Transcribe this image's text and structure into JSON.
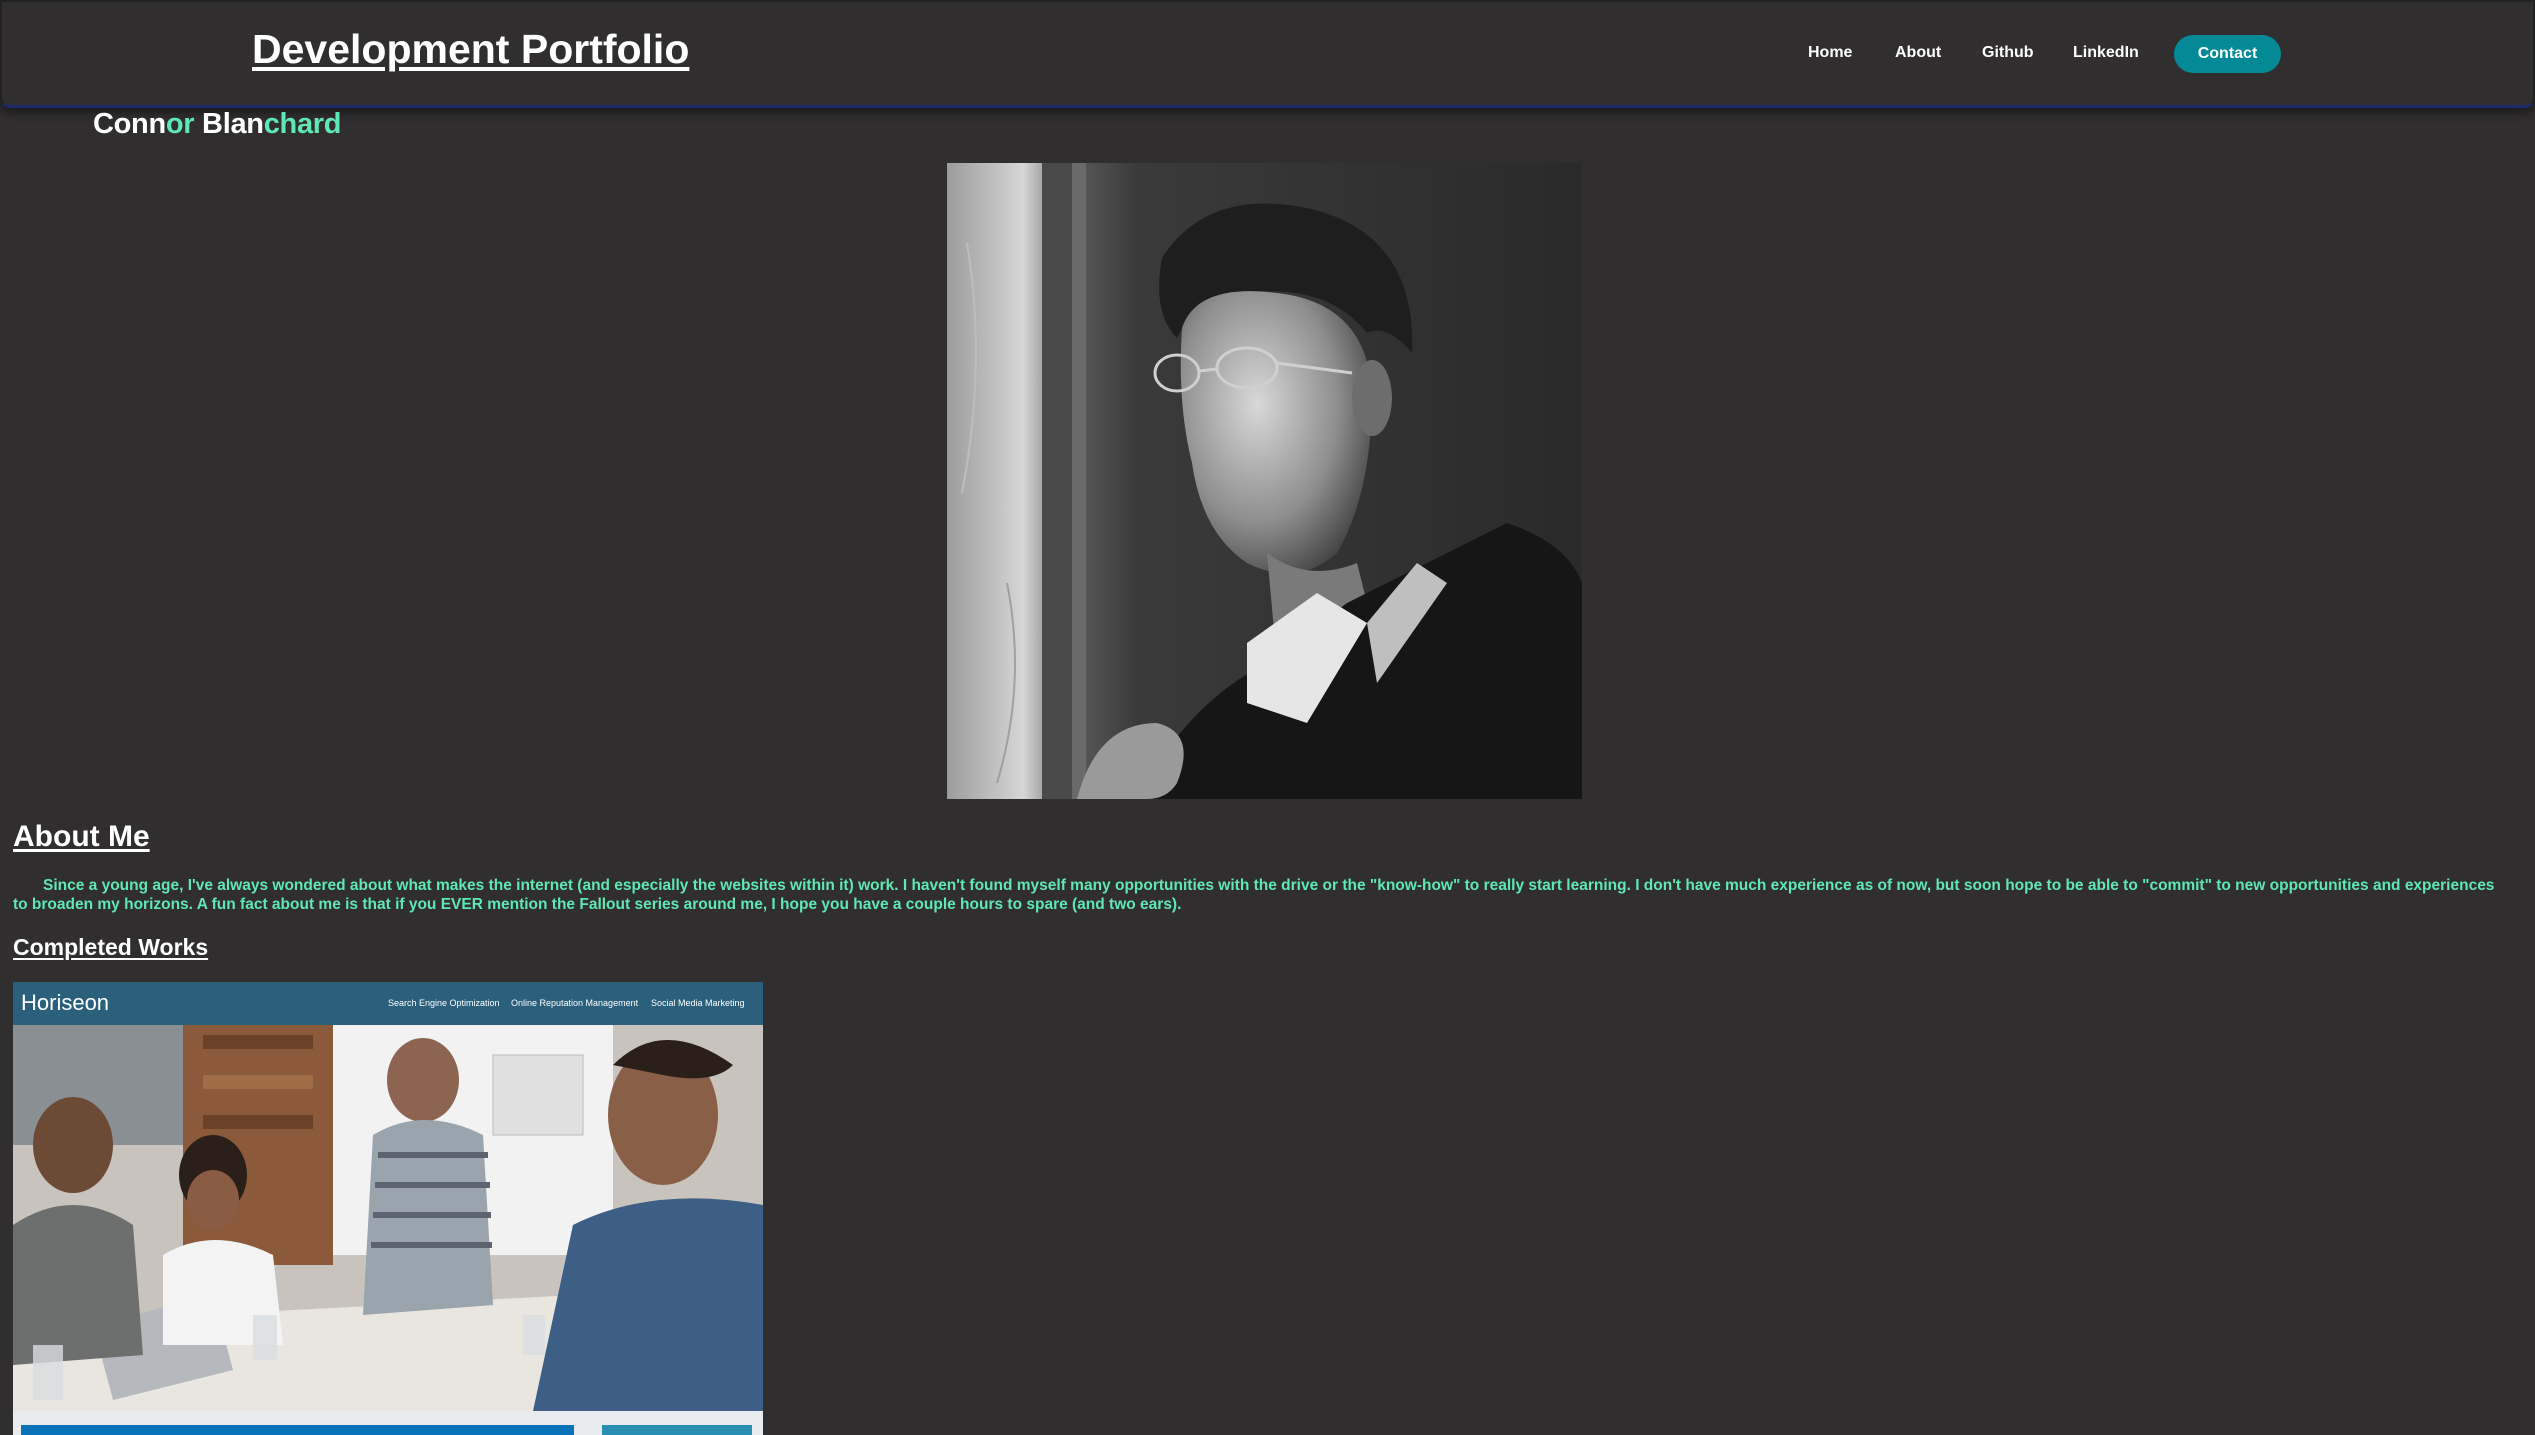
{
  "header": {
    "brand": "Development Portfolio",
    "nav": {
      "home": "Home",
      "about": "About",
      "github": "Github",
      "linkedin": "LinkedIn",
      "contact": "Contact"
    }
  },
  "name": {
    "parts": [
      "Conn",
      "or",
      " Blan",
      "chard"
    ]
  },
  "portrait": {
    "icon": "portrait-photo"
  },
  "about": {
    "title": "About Me",
    "text": "Since a young age, I've always wondered about what makes the internet (and especially the websites within it) work. I haven't found myself many opportunities with the drive or the \"know-how\" to really start learning. I don't have much experience as of now, but soon hope to be able to \"commit\" to new opportunities and experiences to broaden my horizons. A fun fact about me is that if you EVER mention the Fallout series around me, I hope you have a couple hours to spare (and two ears)."
  },
  "works": {
    "title": "Completed Works",
    "projects": [
      {
        "logo": "Horiseon",
        "nav": [
          "Search Engine Optimization",
          "Online Reputation Management",
          "Social Media Marketing"
        ]
      }
    ]
  },
  "colors": {
    "background": "#302e2f",
    "accent_green": "#5fe8b4",
    "contact_button": "#038a96",
    "header_border": "#1d2a6e"
  }
}
